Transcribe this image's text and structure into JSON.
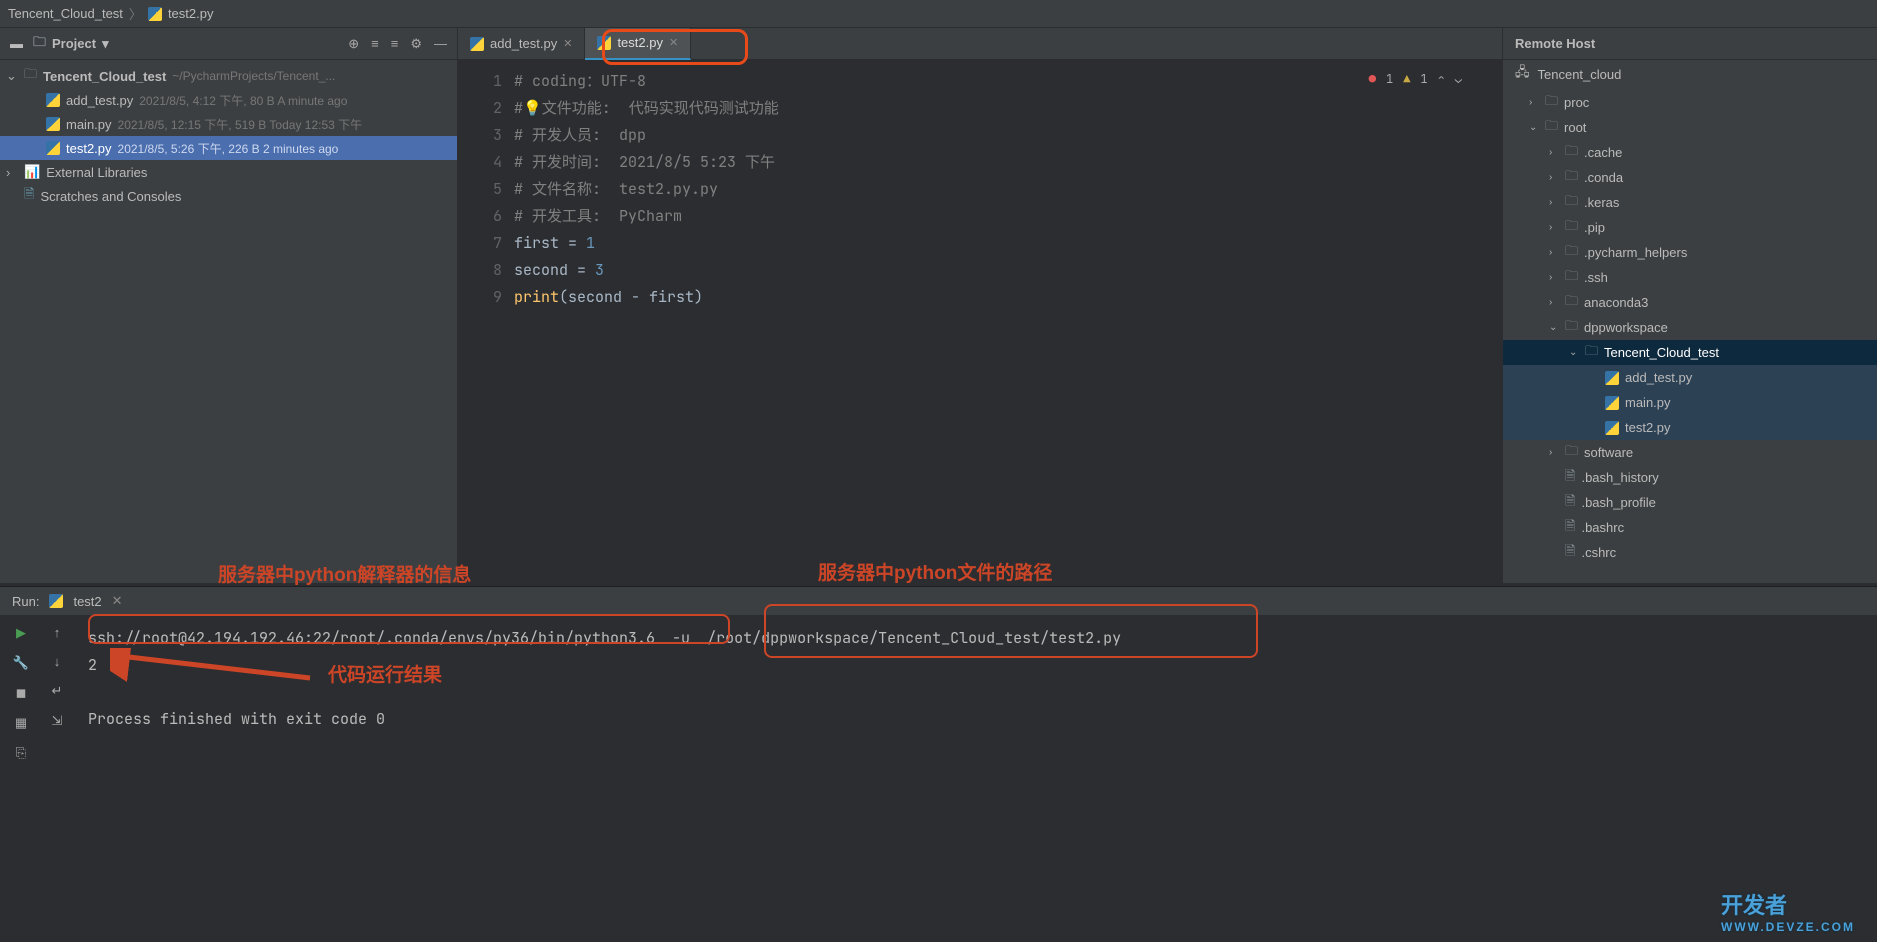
{
  "breadcrumb": {
    "root": "Tencent_Cloud_test",
    "file": "test2.py"
  },
  "project": {
    "title": "Project",
    "root": {
      "name": "Tencent_Cloud_test",
      "path": "~/PycharmProjects/Tencent_..."
    },
    "files": [
      {
        "name": "add_test.py",
        "meta": "2021/8/5, 4:12 下午, 80 B A minute ago"
      },
      {
        "name": "main.py",
        "meta": "2021/8/5, 12:15 下午, 519 B Today 12:53 下午"
      },
      {
        "name": "test2.py",
        "meta": "2021/8/5, 5:26 下午, 226 B 2 minutes ago"
      }
    ],
    "externalLibs": "External Libraries",
    "scratches": "Scratches and Consoles"
  },
  "tabs": [
    {
      "label": "add_test.py"
    },
    {
      "label": "test2.py"
    }
  ],
  "inspection": {
    "errors": "1",
    "warnings": "1"
  },
  "code": {
    "l1": "# coding：UTF-8",
    "l2a": "#",
    "l2b": "文件功能:",
    "l2c": "代码实现代码测试功能",
    "l3a": "# 开发人员:",
    "l3b": "dpp",
    "l4a": "# 开发时间:",
    "l4b": "2021/8/5 5:23 下午",
    "l5a": "# 文件名称:",
    "l5b": "test2.py.py",
    "l6a": "# 开发工具:",
    "l6b": "PyCharm",
    "l7a": "first = ",
    "l7b": "1",
    "l8a": "second = ",
    "l8b": "3",
    "l9a": "print",
    "l9b": "(second - first)"
  },
  "gutter": [
    "1",
    "2",
    "3",
    "4",
    "5",
    "6",
    "7",
    "8",
    "9"
  ],
  "remote": {
    "title": "Remote Host",
    "server": "Tencent_cloud",
    "tree": [
      {
        "d": 1,
        "chev": "›",
        "icon": "folder",
        "name": "proc"
      },
      {
        "d": 1,
        "chev": "⌄",
        "icon": "folder",
        "name": "root"
      },
      {
        "d": 2,
        "chev": "›",
        "icon": "folder",
        "name": ".cache"
      },
      {
        "d": 2,
        "chev": "›",
        "icon": "folder",
        "name": ".conda"
      },
      {
        "d": 2,
        "chev": "›",
        "icon": "folder",
        "name": ".keras"
      },
      {
        "d": 2,
        "chev": "›",
        "icon": "folder",
        "name": ".pip"
      },
      {
        "d": 2,
        "chev": "›",
        "icon": "folder",
        "name": ".pycharm_helpers"
      },
      {
        "d": 2,
        "chev": "›",
        "icon": "folder",
        "name": ".ssh"
      },
      {
        "d": 2,
        "chev": "›",
        "icon": "folder",
        "name": "anaconda3"
      },
      {
        "d": 2,
        "chev": "⌄",
        "icon": "folder",
        "name": "dppworkspace"
      },
      {
        "d": 3,
        "chev": "⌄",
        "icon": "folder",
        "name": "Tencent_Cloud_test",
        "sel": true
      },
      {
        "d": 4,
        "chev": "",
        "icon": "py",
        "name": "add_test.py",
        "sub": true
      },
      {
        "d": 4,
        "chev": "",
        "icon": "py",
        "name": "main.py",
        "sub": true
      },
      {
        "d": 4,
        "chev": "",
        "icon": "py",
        "name": "test2.py",
        "sub": true
      },
      {
        "d": 2,
        "chev": "›",
        "icon": "folder",
        "name": "software"
      },
      {
        "d": 2,
        "chev": "",
        "icon": "file",
        "name": ".bash_history"
      },
      {
        "d": 2,
        "chev": "",
        "icon": "file",
        "name": ".bash_profile"
      },
      {
        "d": 2,
        "chev": "",
        "icon": "file",
        "name": ".bashrc"
      },
      {
        "d": 2,
        "chev": "",
        "icon": "file",
        "name": ".cshrc"
      }
    ]
  },
  "run": {
    "label": "Run:",
    "config": "test2",
    "ssh": "ssh://root@42.194.192.46:22/root/.conda/envs/py36/bin/python3.6",
    "flag": "-u",
    "path": "/root/dppworkspace/Tencent_Cloud_test/test2.py",
    "output": "2",
    "exitmsg": "Process finished with exit code 0"
  },
  "annot": {
    "interpreter": "服务器中python解释器的信息",
    "filepath": "服务器中python文件的路径",
    "result": "代码运行结果"
  },
  "watermark": {
    "main": "开发者",
    "sub": "WWW.DEVZE.COM"
  }
}
